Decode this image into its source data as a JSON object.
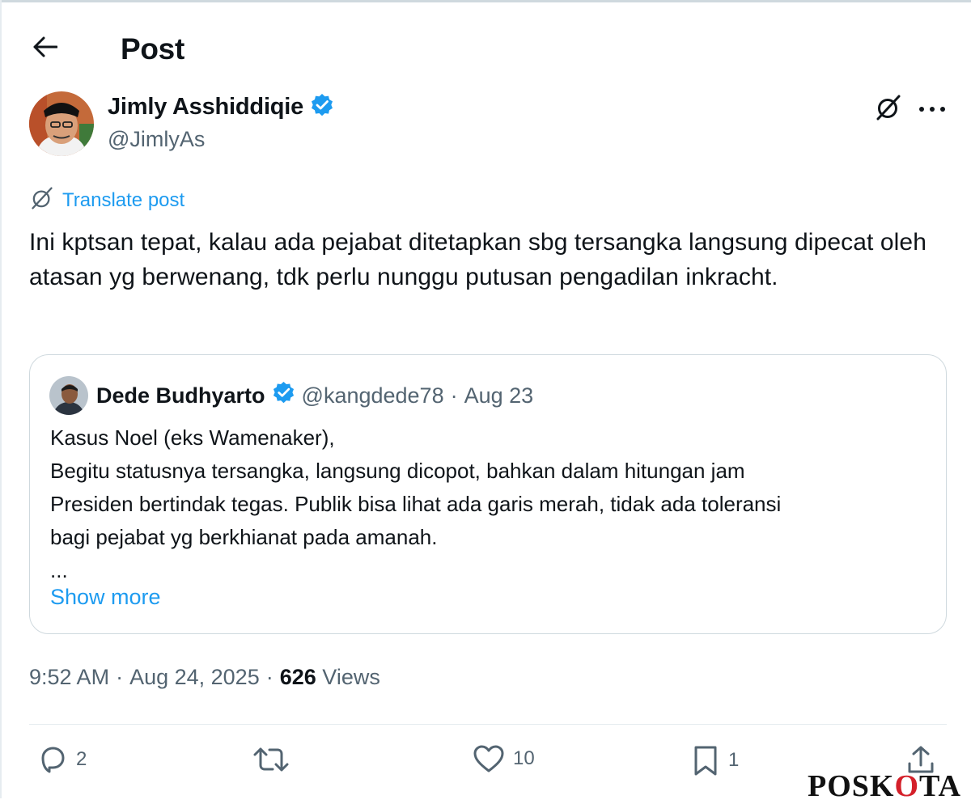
{
  "header": {
    "title": "Post"
  },
  "post": {
    "author_name": "Jimly Asshiddiqie",
    "author_handle": "@JimlyAs",
    "translate_label": "Translate post",
    "text": "Ini kptsan tepat, kalau ada pejabat ditetapkan sbg tersangka langsung dipecat oleh atasan yg berwenang, tdk perlu nunggu putusan pengadilan inkracht.",
    "time": "9:52 AM",
    "date": "Aug 24, 2025",
    "views_count": "626",
    "views_label": "Views"
  },
  "quote": {
    "author_name": "Dede Budhyarto",
    "author_handle": "@kangdede78",
    "separator": "·",
    "date": "Aug 23",
    "lines": [
      "Kasus Noel (eks Wamenaker),",
      "Begitu statusnya tersangka, langsung dicopot, bahkan dalam hitungan jam",
      "Presiden bertindak tegas. Publik bisa lihat ada garis merah, tidak ada toleransi",
      "bagi pejabat yg berkhianat pada amanah.",
      "..."
    ],
    "show_more_label": "Show more"
  },
  "actions": {
    "replies": "2",
    "reposts": "",
    "likes": "10",
    "bookmarks": "1"
  },
  "icons": {
    "back": "arrow-left-icon",
    "verified": "verified-badge-icon",
    "grok": "grok-icon",
    "more": "more-icon",
    "reply": "reply-icon",
    "repost": "repost-icon",
    "like": "heart-icon",
    "bookmark": "bookmark-icon",
    "share": "share-icon"
  },
  "colors": {
    "accent": "#1d9bf0",
    "text_primary": "#0f1419",
    "text_secondary": "#536471",
    "border": "#cfd9de",
    "watermark_accent": "#d4202a"
  },
  "watermark": {
    "text_left": "POSK",
    "text_accent": "O",
    "text_right": "TA"
  }
}
